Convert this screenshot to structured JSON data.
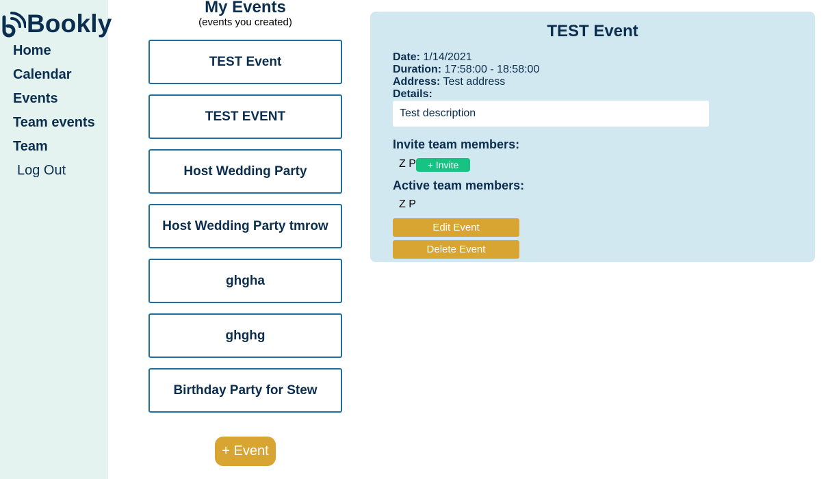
{
  "app": {
    "name": "Bookly",
    "logo_icon": "wifi-b-icon"
  },
  "nav": {
    "items": [
      "Home",
      "Calendar",
      "Events",
      "Team events",
      "Team"
    ],
    "logout": "Log Out"
  },
  "events": {
    "title": "My Events",
    "subtitle": "(events you created)",
    "list": [
      "TEST Event",
      "TEST EVENT",
      "Host Wedding Party",
      "Host Wedding Party tmrow",
      "ghgha",
      "ghghg",
      "Birthday Party for Stew"
    ],
    "add_label": "+ Event"
  },
  "detail": {
    "title": "TEST Event",
    "date_label": "Date:",
    "date": "1/14/2021",
    "duration_label": "Duration:",
    "duration": "17:58:00 - 18:58:00",
    "address_label": "Address:",
    "address": "Test address",
    "details_label": "Details:",
    "details": "Test description",
    "invite_heading": "Invite team members:",
    "invite_member": "Z P",
    "invite_label": "+ Invite",
    "active_heading": "Active team members:",
    "active_member": "Z P",
    "edit_label": "Edit Event",
    "delete_label": "Delete Event"
  },
  "colors": {
    "navy": "#0b2e4f",
    "sidebar_bg": "#e4f3f0",
    "panel_bg": "#d2e8f1",
    "card_border": "#1f6ea0",
    "gold": "#d8a432",
    "green": "#16c383"
  }
}
